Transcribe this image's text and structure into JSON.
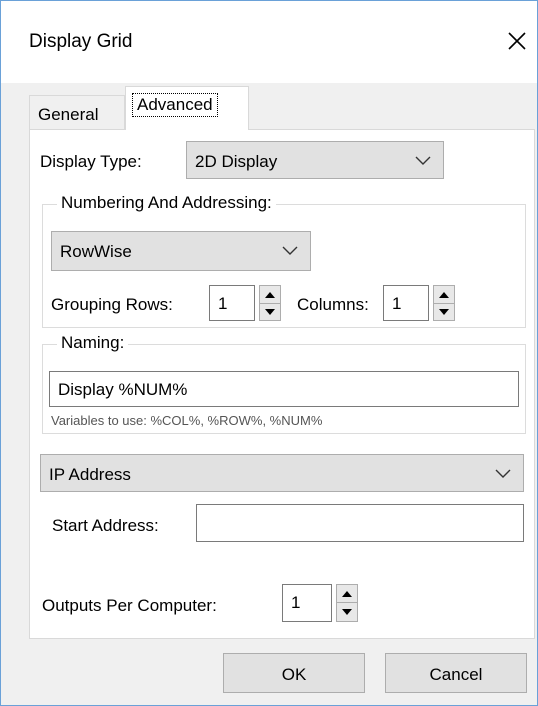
{
  "window": {
    "title": "Display Grid"
  },
  "tabs": [
    {
      "label": "General"
    },
    {
      "label": "Advanced"
    }
  ],
  "display_type": {
    "label": "Display Type:",
    "value": "2D Display"
  },
  "numbering": {
    "caption": "Numbering And Addressing:",
    "order_value": "RowWise",
    "grouping_rows_label": "Grouping Rows:",
    "grouping_rows_value": "1",
    "columns_label": "Columns:",
    "columns_value": "1"
  },
  "naming": {
    "caption": "Naming:",
    "value": "Display %NUM%",
    "hint": "Variables to use: %COL%, %ROW%, %NUM%"
  },
  "address": {
    "type_value": "IP Address",
    "start_label": "Start Address:",
    "start_value": ""
  },
  "outputs": {
    "label": "Outputs Per Computer:",
    "value": "1"
  },
  "buttons": {
    "ok": "OK",
    "cancel": "Cancel"
  },
  "icons": {
    "close": "close-icon",
    "dropdown": "chevron-down-icon",
    "spin_up": "triangle-up-icon",
    "spin_down": "triangle-down-icon"
  }
}
